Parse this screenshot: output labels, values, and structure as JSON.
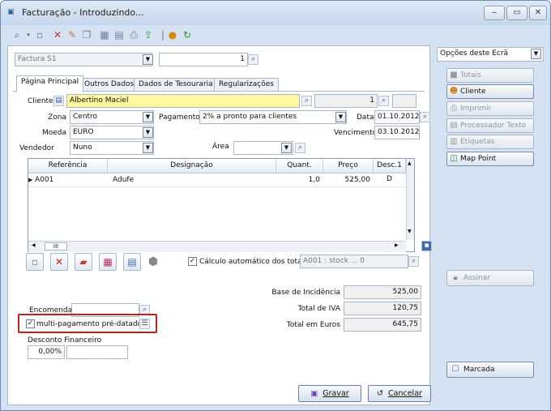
{
  "window": {
    "title": "Facturação - Introduzindo...",
    "controls": {
      "minimize": "‒",
      "maximize": "▭",
      "close": "✕"
    }
  },
  "toolbar": {
    "icons": [
      "search-icon",
      "new-document-icon",
      "delete-icon",
      "edit-icon",
      "copy-icon",
      "calculator-icon",
      "print-preview-icon",
      "printer-icon",
      "export-icon",
      "lock-icon",
      "refresh-icon"
    ]
  },
  "doc": {
    "type_value": "Factura S1",
    "number_value": "1"
  },
  "tabs": [
    {
      "label": "Página Principal",
      "active": true
    },
    {
      "label": "Outros Dados"
    },
    {
      "label": "Dados de Tesouraria"
    },
    {
      "label": "Regularizações"
    }
  ],
  "form": {
    "cliente_label": "Cliente",
    "cliente_value": "Albertino Maciel",
    "cliente_number": "1",
    "zona_label": "Zona",
    "zona_value": "Centro",
    "pagamento_label": "Pagamento",
    "pagamento_value": "2% a pronto para clientes",
    "data_label": "Data",
    "data_value": "01.10.2012",
    "moeda_label": "Moeda",
    "moeda_value": "EURO",
    "vencimento_label": "Vencimento",
    "vencimento_value": "03.10.2012",
    "vendedor_label": "Vendedor",
    "vendedor_value": "Nuno",
    "area_label": "Área",
    "area_value": ""
  },
  "grid": {
    "columns": [
      "Referência",
      "Designação",
      "Quant.",
      "Preço",
      "Desc.1 D"
    ],
    "rows": [
      {
        "ref": "A001",
        "desig": "Adufe",
        "quant": "1,0",
        "preco": "525,00",
        "desc": ""
      }
    ],
    "scroll_label": "III"
  },
  "calc": {
    "auto_label": "Cálculo automático dos totais",
    "auto_checked": true,
    "stock_text": "A001 : stock ... 0"
  },
  "totals": {
    "base_label": "Base de Incidência",
    "base_value": "525,00",
    "iva_label": "Total de IVA",
    "iva_value": "120,75",
    "euros_label": "Total em Euros",
    "euros_value": "645,75"
  },
  "bottom": {
    "encomenda_label": "Encomenda",
    "encomenda_value": "",
    "multi_label": "multi-pagamento pré-datado",
    "multi_checked": true,
    "desconto_label": "Desconto Financeiro",
    "desconto_value": "0,00%",
    "desconto_extra": ""
  },
  "actions": {
    "gravar": "Gravar",
    "cancelar": "Cancelar"
  },
  "side": {
    "dropdown_value": "Opções deste Ecrã",
    "buttons": [
      {
        "label": "Totais",
        "enabled": false
      },
      {
        "label": "Cliente",
        "enabled": true
      },
      {
        "label": "Imprimir",
        "enabled": false
      },
      {
        "label": "Processador Texto",
        "enabled": false
      },
      {
        "label": "Etiquetas",
        "enabled": false
      },
      {
        "label": "Map Point",
        "enabled": true
      }
    ],
    "assinar": "Assinar",
    "marcada": "Marcada"
  },
  "colors": {
    "highlight": "#c0201e",
    "cliente_bg": "#fff6a0",
    "window_bg": "#d4e2f2"
  }
}
